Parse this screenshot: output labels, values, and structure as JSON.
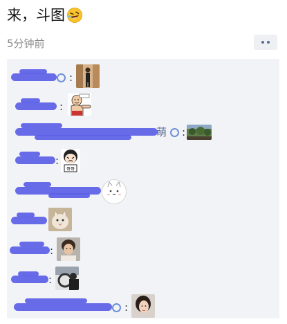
{
  "post": {
    "text": "来，斗图",
    "emoji": "rofl-face-emoji",
    "timestamp": "5分钟前"
  },
  "more_button": {
    "icon": "more-dots-icon"
  },
  "comments": [
    {
      "visible_name": "",
      "sticker": "person-standing-photo"
    },
    {
      "visible_name": "",
      "sticker": "pointing-meme-sticker"
    },
    {
      "visible_name": "萌",
      "sticker": "landscape-photo"
    },
    {
      "visible_name": "",
      "sticker": "crying-meme-sticker"
    },
    {
      "visible_name": "",
      "sticker": "white-cat-emoji"
    },
    {
      "visible_name": "",
      "sticker": "cat-photo"
    },
    {
      "visible_name": "",
      "sticker": "portrait-photo"
    },
    {
      "visible_name": "",
      "sticker": "car-interior-photo"
    },
    {
      "visible_name": "",
      "sticker": "girl-selfie-photo"
    }
  ],
  "colors": {
    "redaction_scribble": "#5b5fe6",
    "comment_bg": "#f2f3f7",
    "name_link": "#5b6b94"
  }
}
